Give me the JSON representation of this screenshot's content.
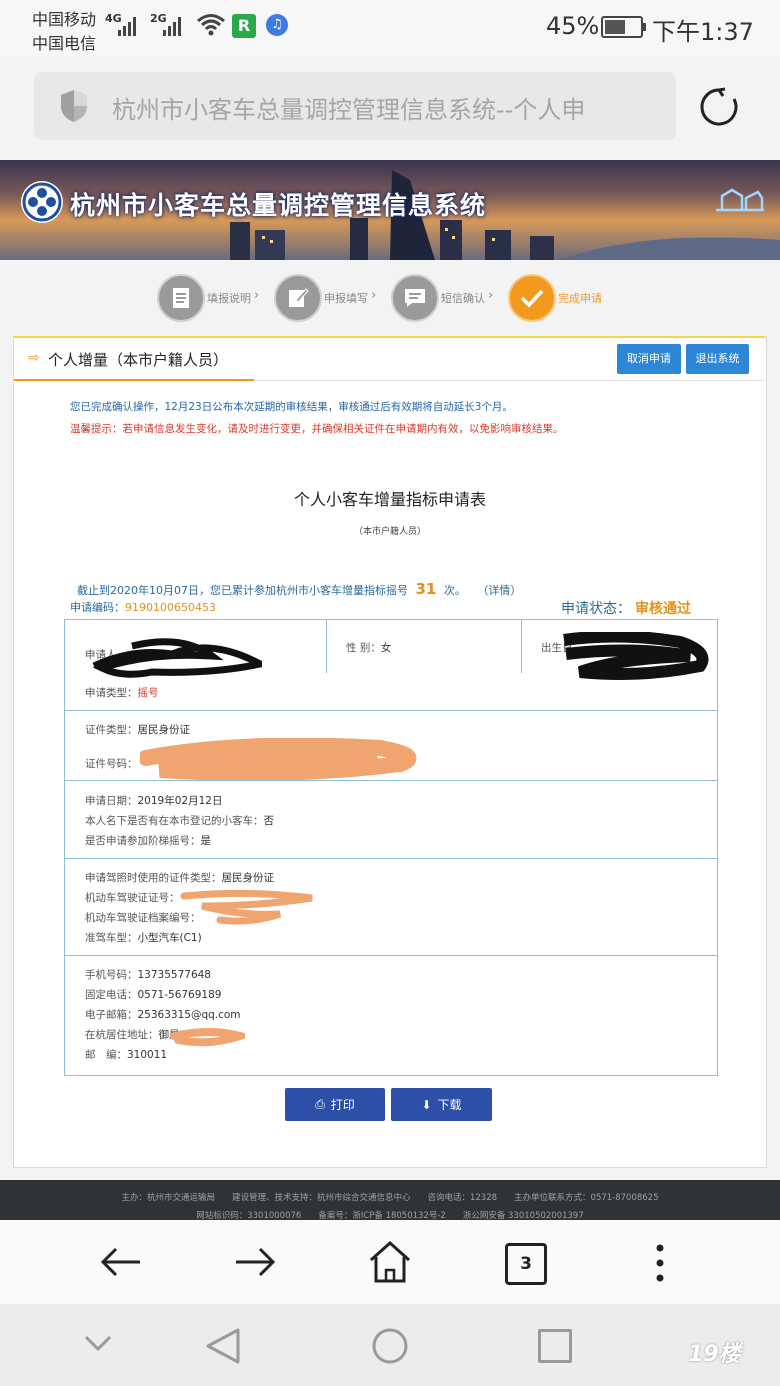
{
  "status": {
    "carrier1": "中国移动",
    "carrier2": "中国电信",
    "net1": "4G",
    "net2": "2G",
    "battery": "45%",
    "time": "下午1:37"
  },
  "browser": {
    "title": "杭州市小客车总量调控管理信息系统--个人申",
    "tabs_count": "3"
  },
  "banner": {
    "title": "杭州市小客车总量调控管理信息系统"
  },
  "steps": [
    {
      "label": "填报说明"
    },
    {
      "label": "申报填写"
    },
    {
      "label": "短信确认"
    },
    {
      "label": "完成申请"
    }
  ],
  "page": {
    "section_title": "个人增量（本市户籍人员）",
    "cancel_btn": "取消申请",
    "exit_btn": "退出系统",
    "notice1": "您已完成确认操作，12月23日公布本次延期的审核结果，审核通过后有效期将自动延长3个月。",
    "notice2": "温馨提示：若申请信息发生变化，请及时进行变更，并确保相关证件在申请期内有效，以免影响审核结果。",
    "form_title": "个人小客车增量指标申请表",
    "form_subtitle": "（本市户籍人员）",
    "summary_prefix": "截止到2020年10月07日，您已累计参加杭州市小客车增量指标摇号",
    "summary_count": "31",
    "summary_suffix": "次。",
    "summary_link": "（详情）",
    "code_label": "申请编码：",
    "code_value": "9190100650453",
    "status_label": "申请状态：",
    "status_value": "审核通过"
  },
  "form": {
    "applicant_label": "申请人",
    "gender_label": "性 别：",
    "gender_value": "女",
    "birth_label": "出生日",
    "apply_type_label": "申请类型：",
    "apply_type_value": "摇号",
    "id_type_label": "证件类型：",
    "id_type_value": "居民身份证",
    "id_no_label": "证件号码：",
    "apply_date_label": "申请日期：",
    "apply_date_value": "2019年02月12日",
    "owns_car_label": "本人名下是否有在本市登记的小客车：",
    "owns_car_value": "否",
    "tiered_label": "是否申请参加阶梯摇号：",
    "tiered_value": "是",
    "license_id_type_label": "申请驾照时使用的证件类型：",
    "license_id_type_value": "居民身份证",
    "license_no_label": "机动车驾驶证证号：",
    "license_file_label": "机动车驾驶证档案编号：",
    "vehicle_class_label": "准驾车型：",
    "vehicle_class_value": "小型汽车(C1)",
    "mobile_label": "手机号码：",
    "mobile_value": "13735577648",
    "phone_label": "固定电话：",
    "phone_value": "0571-56769189",
    "email_label": "电子邮箱：",
    "email_value": "25363315@qq.com",
    "address_label": "在杭居住地址：",
    "address_value": "御晨",
    "zip_label": "邮　编：",
    "zip_value": "310011"
  },
  "actions": {
    "print": "打印",
    "download": "下载"
  },
  "footer": {
    "line1": "主办：杭州市交通运输局　　建设管理、技术支持：杭州市综合交通信息中心　　咨询电话：12328　　主办单位联系方式：0571-87008625",
    "line2": "网站标识码：3301000076　　备案号：浙ICP备 18050132号-2　　浙公网安备 33010502001397"
  },
  "colors": {
    "accent_blue": "#2e86d6",
    "status_orange": "#e3901d",
    "notice_red": "#d93a2b",
    "button_dark_blue": "#2c4fa8"
  }
}
